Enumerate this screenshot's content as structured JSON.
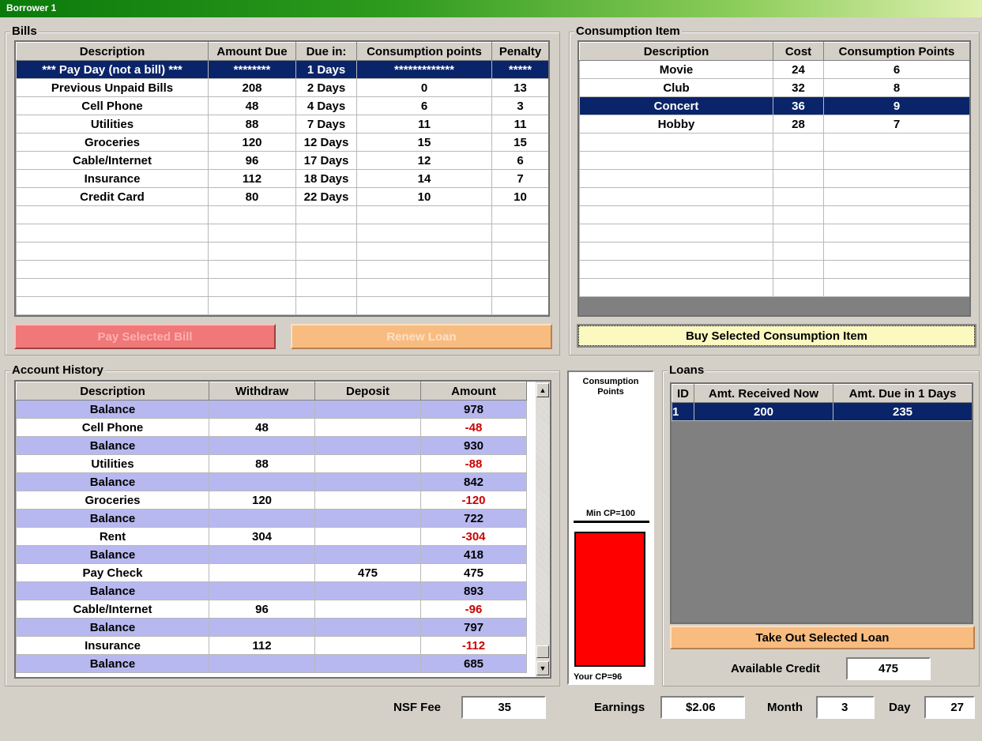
{
  "window": {
    "title": "Borrower 1"
  },
  "bills": {
    "title": "Bills",
    "columns": [
      "Description",
      "Amount Due",
      "Due in:",
      "Consumption points",
      "Penalty"
    ],
    "rows": [
      [
        "*** Pay Day (not a bill) ***",
        "********",
        "1 Days",
        "*************",
        "*****"
      ],
      [
        "Previous Unpaid Bills",
        "208",
        "2 Days",
        "0",
        "13"
      ],
      [
        "Cell Phone",
        "48",
        "4 Days",
        "6",
        "3"
      ],
      [
        "Utilities",
        "88",
        "7 Days",
        "11",
        "11"
      ],
      [
        "Groceries",
        "120",
        "12 Days",
        "15",
        "15"
      ],
      [
        "Cable/Internet",
        "96",
        "17 Days",
        "12",
        "6"
      ],
      [
        "Insurance",
        "112",
        "18 Days",
        "14",
        "7"
      ],
      [
        "Credit Card",
        "80",
        "22 Days",
        "10",
        "10"
      ]
    ],
    "selected_row": 0,
    "pay_button": "Pay Selected Bill",
    "renew_button": "Renew Loan"
  },
  "consumption": {
    "title": "Consumption Item",
    "columns": [
      "Description",
      "Cost",
      "Consumption Points"
    ],
    "rows": [
      [
        "Movie",
        "24",
        "6"
      ],
      [
        "Club",
        "32",
        "8"
      ],
      [
        "Concert",
        "36",
        "9"
      ],
      [
        "Hobby",
        "28",
        "7"
      ]
    ],
    "selected_row": 2,
    "buy_button": "Buy Selected Consumption Item"
  },
  "history": {
    "title": "Account History",
    "columns": [
      "Description",
      "Withdraw",
      "Deposit",
      "Amount"
    ],
    "rows": [
      [
        "Balance",
        "",
        "",
        "978"
      ],
      [
        "Cell Phone",
        "48",
        "",
        "-48"
      ],
      [
        "Balance",
        "",
        "",
        "930"
      ],
      [
        "Utilities",
        "88",
        "",
        "-88"
      ],
      [
        "Balance",
        "",
        "",
        "842"
      ],
      [
        "Groceries",
        "120",
        "",
        "-120"
      ],
      [
        "Balance",
        "",
        "",
        "722"
      ],
      [
        "Rent",
        "304",
        "",
        "-304"
      ],
      [
        "Balance",
        "",
        "",
        "418"
      ],
      [
        "Pay Check",
        "",
        "475",
        "475"
      ],
      [
        "Balance",
        "",
        "",
        "893"
      ],
      [
        "Cable/Internet",
        "96",
        "",
        "-96"
      ],
      [
        "Balance",
        "",
        "",
        "797"
      ],
      [
        "Insurance",
        "112",
        "",
        "-112"
      ],
      [
        "Balance",
        "",
        "",
        "685"
      ]
    ],
    "scroll_up_icon": "triangle-up",
    "scroll_down_icon": "triangle-down"
  },
  "cp_meter": {
    "title": "Consumption Points",
    "min_label": "Min CP=100",
    "your_label": "Your CP=96",
    "min_cp": 100,
    "your_cp": 96,
    "bar_color": "#ff0000"
  },
  "loans": {
    "title": "Loans",
    "columns": [
      "ID",
      "Amt. Received Now",
      "Amt. Due in 1 Days"
    ],
    "rows": [
      [
        "1",
        "200",
        "235"
      ]
    ],
    "selected_row": 0,
    "take_button": "Take Out Selected Loan",
    "available_credit_label": "Available Credit",
    "available_credit": "475"
  },
  "footer": {
    "nsf_label": "NSF Fee",
    "nsf_value": "35",
    "earnings_label": "Earnings",
    "earnings_value": "$2.06",
    "month_label": "Month",
    "month_value": "3",
    "day_label": "Day",
    "day_value": "27"
  },
  "colors": {
    "selection": "#0a246a",
    "balance_row": "#b8b8f0",
    "negative": "#cc0000",
    "pay_button": "#f07878",
    "loan_button": "#f8bc80",
    "buy_button": "#fbf8c0"
  }
}
